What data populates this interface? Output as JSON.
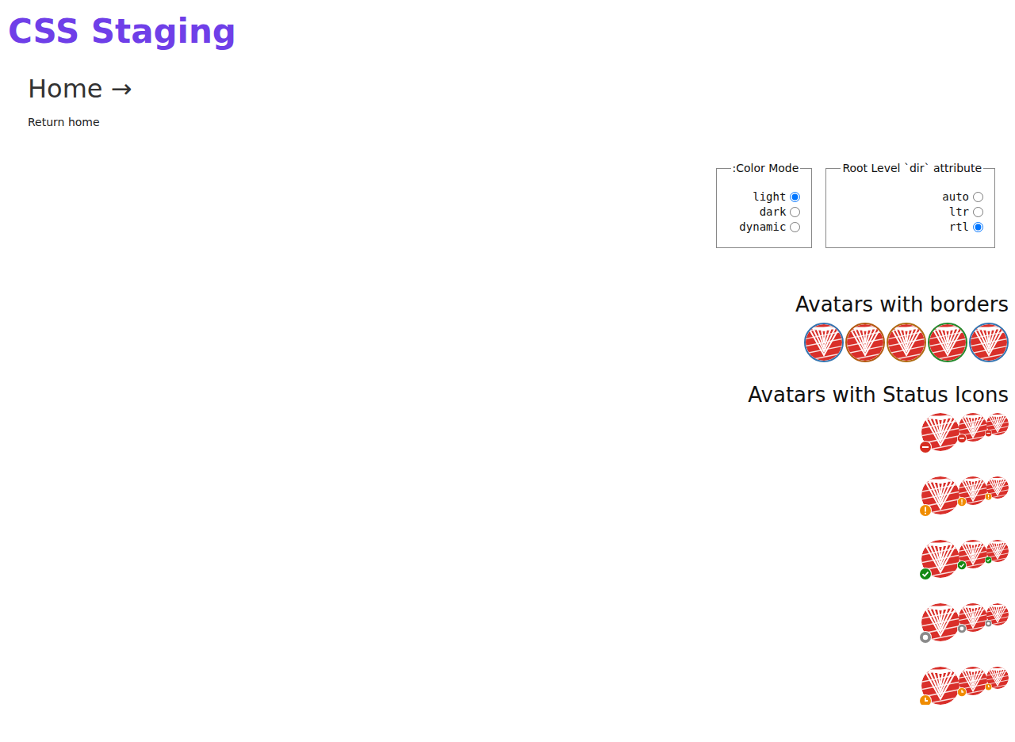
{
  "header": {
    "title": "CSS Staging"
  },
  "page": {
    "heading": "Home →",
    "link": "Return home"
  },
  "controls": [
    {
      "legend": ":Color Mode",
      "options": [
        {
          "label": "light",
          "selected": true
        },
        {
          "label": "dark",
          "selected": false
        },
        {
          "label": "dynamic",
          "selected": false
        }
      ]
    },
    {
      "legend": "Root Level `dir` attribute",
      "options": [
        {
          "label": "auto",
          "selected": false
        },
        {
          "label": "ltr",
          "selected": false
        },
        {
          "label": "rtl",
          "selected": true
        }
      ]
    }
  ],
  "bordered_avatars": {
    "heading": "Avatars with borders",
    "items": [
      {
        "color": "#3574b0"
      },
      {
        "color": "#b35a10"
      },
      {
        "color": "#b06a10"
      },
      {
        "color": "#23882a"
      },
      {
        "color": "#3574b0"
      }
    ]
  },
  "status_avatars": {
    "heading": "Avatars with Status Icons",
    "rows": [
      {
        "kind": "busy",
        "color": "#d62d20"
      },
      {
        "kind": "away",
        "color": "#f08c00"
      },
      {
        "kind": "online",
        "color": "#148a14"
      },
      {
        "kind": "offline",
        "color": "#8a8a8a"
      },
      {
        "kind": "idle",
        "color": "#f08c00"
      }
    ]
  }
}
